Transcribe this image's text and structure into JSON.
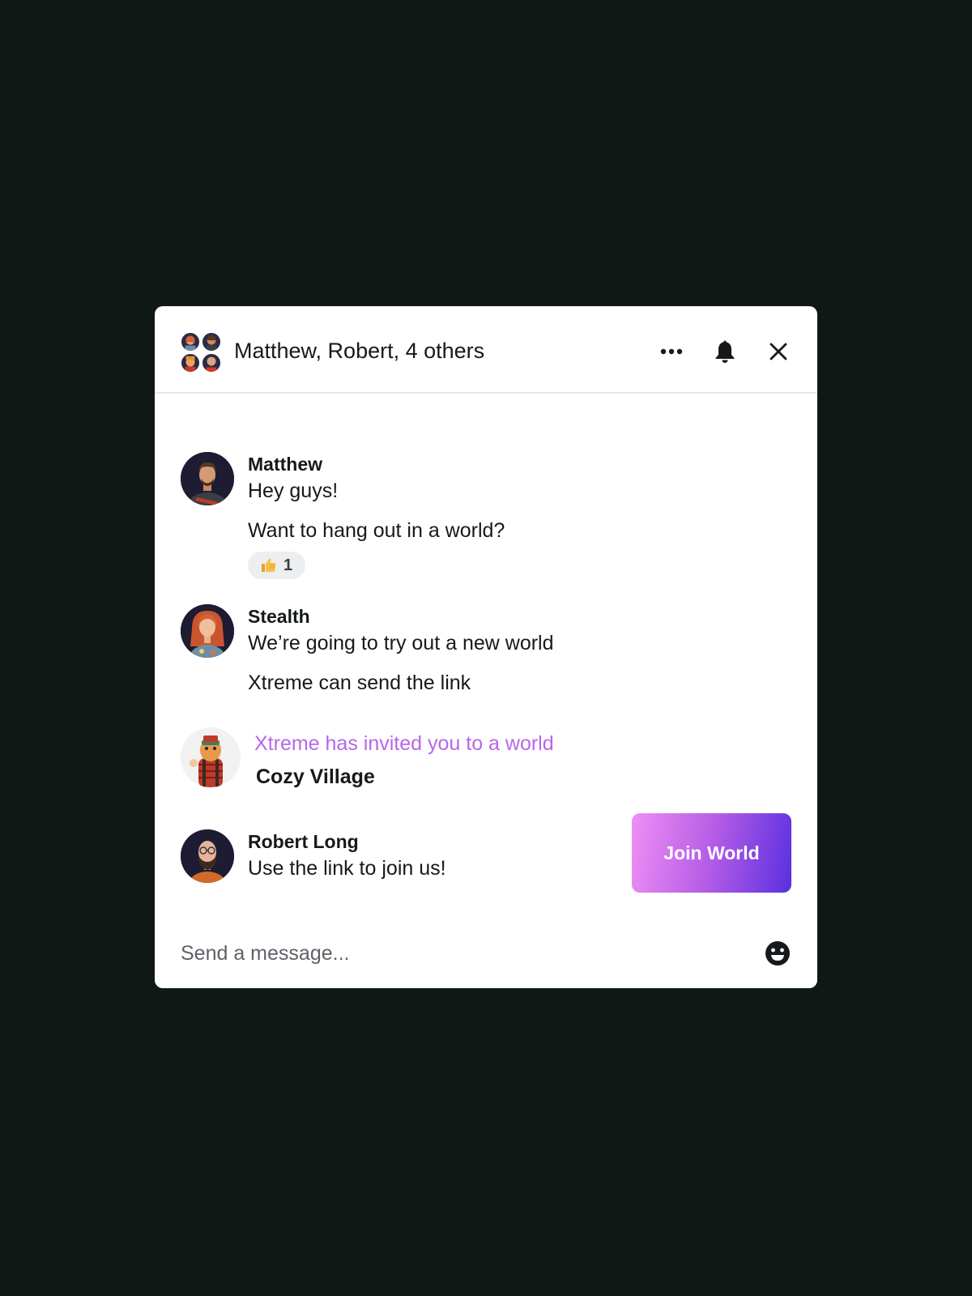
{
  "header": {
    "title": "Matthew, Robert, 4 others",
    "icons": [
      "more-icon",
      "bell-icon",
      "close-icon"
    ]
  },
  "messages": [
    {
      "sender": "Matthew",
      "lines": [
        "Hey guys!",
        "Want to hang out in a world?"
      ],
      "reaction": {
        "emoji": "thumbs-up",
        "count": "1"
      }
    },
    {
      "sender": "Stealth",
      "lines": [
        "We’re going to try out a new world",
        "Xtreme can send the link"
      ]
    },
    {
      "invite": {
        "text": "Xtreme has invited you to a world",
        "world": "Cozy Village",
        "button": "Join World"
      }
    },
    {
      "sender": "Robert Long",
      "lines": [
        "Use the link to join us!"
      ]
    }
  ],
  "composer": {
    "placeholder": "Send a message..."
  },
  "colors": {
    "background": "#101815",
    "invite_text": "#b866ea",
    "button_gradient_start": "#ef8ff5",
    "button_gradient_end": "#5a30e0"
  }
}
